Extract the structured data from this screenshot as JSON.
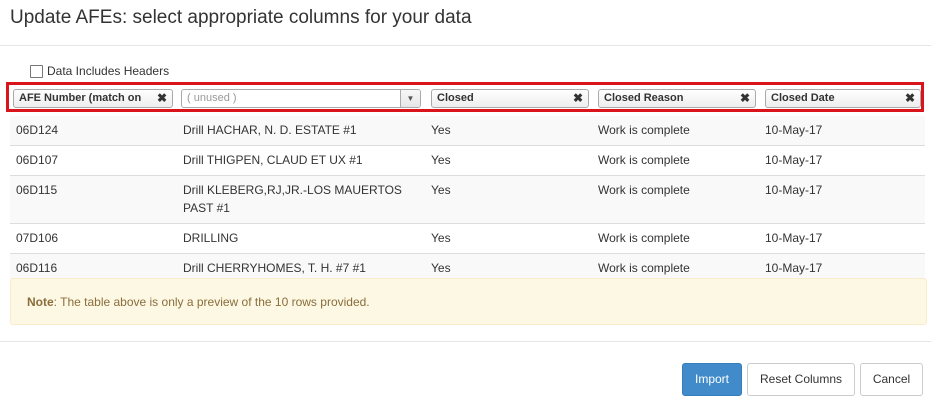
{
  "dialog": {
    "title": "Update AFEs: select appropriate columns for your data"
  },
  "options": {
    "headers_checkbox_label": "Data Includes Headers",
    "headers_checked": false
  },
  "columns": [
    {
      "label": "AFE Number (match on",
      "clear_icon": "✖"
    },
    {
      "label": "( unused )",
      "arrow_icon": "▼"
    },
    {
      "label": "Closed",
      "clear_icon": "✖"
    },
    {
      "label": "Closed Reason",
      "clear_icon": "✖"
    },
    {
      "label": "Closed Date",
      "clear_icon": "✖"
    }
  ],
  "rows": [
    {
      "afe": "06D124",
      "desc": "Drill HACHAR, N. D. ESTATE #1",
      "closed": "Yes",
      "reason": "Work is complete",
      "date": "10-May-17"
    },
    {
      "afe": "06D107",
      "desc": "Drill THIGPEN, CLAUD ET UX #1",
      "closed": "Yes",
      "reason": "Work is complete",
      "date": "10-May-17"
    },
    {
      "afe": "06D115",
      "desc": "Drill KLEBERG,RJ,JR.-LOS MAUERTOS PAST #1",
      "closed": "Yes",
      "reason": "Work is complete",
      "date": "10-May-17"
    },
    {
      "afe": "07D106",
      "desc": "DRILLING",
      "closed": "Yes",
      "reason": "Work is complete",
      "date": "10-May-17"
    },
    {
      "afe": "06D116",
      "desc": "Drill CHERRYHOMES, T. H. #7 #1",
      "closed": "Yes",
      "reason": "Work is complete",
      "date": "10-May-17"
    }
  ],
  "note": {
    "label": "Note",
    "text": ": The table above is only a preview of the 10 rows provided."
  },
  "footer": {
    "import_label": "Import",
    "reset_label": "Reset Columns",
    "cancel_label": "Cancel"
  },
  "colors": {
    "highlight_border": "#d9151b",
    "primary": "#428bca",
    "note_bg": "#fcf8e3",
    "note_text": "#8a6d3b"
  }
}
